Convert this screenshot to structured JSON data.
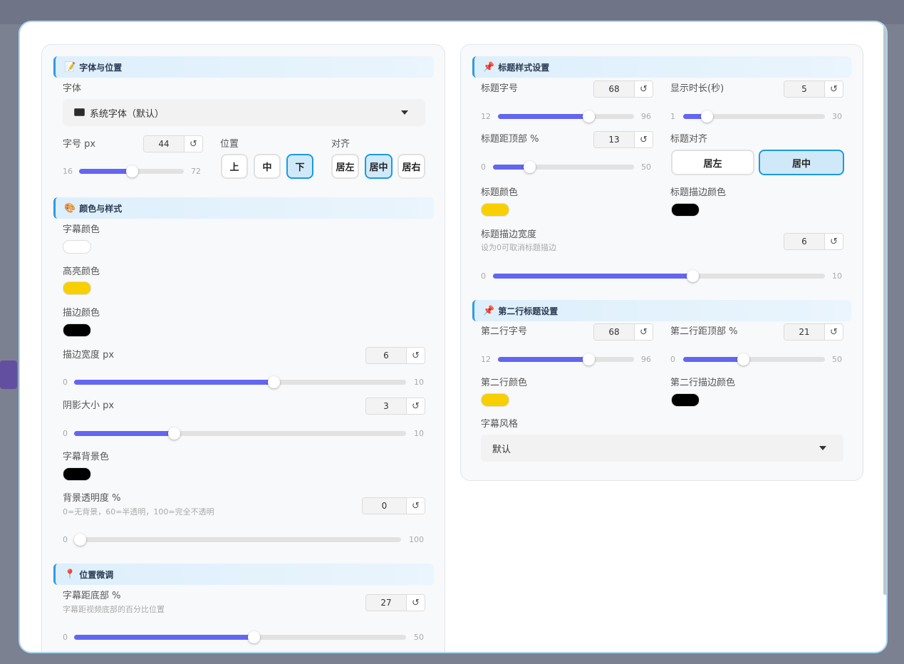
{
  "theme": {
    "accent": "#6366f1",
    "active_border": "#1a9be0",
    "section_border": "#2f9be0"
  },
  "font_position": {
    "title": "字体与位置",
    "icon": "memo-icon",
    "font_label": "字体",
    "font_value": "系统字体（默认）",
    "size_label": "字号 px",
    "size_value": "44",
    "size_min": "16",
    "size_max": "72",
    "size_fraction": 0.5,
    "position_label": "位置",
    "position_options": [
      "上",
      "中",
      "下"
    ],
    "position_selected": "下",
    "align_label": "对齐",
    "align_options": [
      "居左",
      "居中",
      "居右"
    ],
    "align_selected": "居中"
  },
  "color_style": {
    "title": "颜色与样式",
    "icon": "palette-icon",
    "sub_color_label": "字幕颜色",
    "sub_color": "#ffffff",
    "highlight_label": "高亮颜色",
    "highlight_color": "#f8cf00",
    "stroke_color_label": "描边颜色",
    "stroke_color": "#000000",
    "stroke_width_label": "描边宽度 px",
    "stroke_width_value": "6",
    "stroke_width_min": "0",
    "stroke_width_max": "10",
    "stroke_width_fraction": 0.6,
    "shadow_label": "阴影大小 px",
    "shadow_value": "3",
    "shadow_min": "0",
    "shadow_max": "10",
    "shadow_fraction": 0.3,
    "bg_color_label": "字幕背景色",
    "bg_color": "#000000",
    "opacity_label": "背景透明度 %",
    "opacity_hint": "0=无背景，60=半透明，100=完全不透明",
    "opacity_value": "0",
    "opacity_min": "0",
    "opacity_max": "100",
    "opacity_fraction": 0.0
  },
  "position_tune": {
    "title": "位置微调",
    "icon": "pin-icon",
    "bottom_label": "字幕距底部 %",
    "bottom_hint": "字幕距视频底部的百分比位置",
    "bottom_value": "27",
    "bottom_min": "0",
    "bottom_max": "50",
    "bottom_fraction": 0.54
  },
  "title_style": {
    "title": "标题样式设置",
    "icon": "pushpin-icon",
    "size_label": "标题字号",
    "size_value": "68",
    "size_min": "12",
    "size_max": "96",
    "size_fraction": 0.6667,
    "duration_label": "显示时长(秒)",
    "duration_value": "5",
    "duration_min": "1",
    "duration_max": "30",
    "duration_fraction": 0.1667,
    "top_label": "标题距顶部 %",
    "top_value": "13",
    "top_min": "0",
    "top_max": "50",
    "top_fraction": 0.26,
    "align_label": "标题对齐",
    "align_options": [
      "居左",
      "居中"
    ],
    "align_selected": "居中",
    "color_label": "标题颜色",
    "color": "#f8cf00",
    "stroke_color_label": "标题描边颜色",
    "stroke_color": "#000000",
    "stroke_width_label": "标题描边宽度",
    "stroke_width_hint": "设为0可取消标题描边",
    "stroke_width_value": "6",
    "stroke_width_min": "0",
    "stroke_width_max": "10",
    "stroke_width_fraction": 0.6
  },
  "second_line": {
    "title": "第二行标题设置",
    "icon": "pushpin-icon",
    "size_label": "第二行字号",
    "size_value": "68",
    "size_min": "12",
    "size_max": "96",
    "size_fraction": 0.6667,
    "top_label": "第二行距顶部 %",
    "top_value": "21",
    "top_min": "0",
    "top_max": "50",
    "top_fraction": 0.42,
    "color_label": "第二行颜色",
    "color": "#f8cf00",
    "stroke_color_label": "第二行描边颜色",
    "stroke_color": "#000000",
    "style_label": "字幕风格",
    "style_value": "默认"
  }
}
